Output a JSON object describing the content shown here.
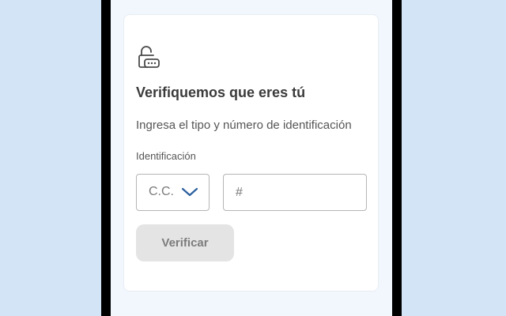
{
  "form": {
    "title": "Verifiquemos que eres tú",
    "subtitle": "Ingresa el tipo y número de identificación",
    "id_label": "Identificación",
    "id_type_selected": "C.C.",
    "id_number_placeholder": "#",
    "id_number_value": "",
    "verify_label": "Verificar"
  },
  "icons": {
    "header_icon": "lock-open-password-icon",
    "select_icon": "chevron-down-icon"
  },
  "colors": {
    "accent": "#2b5f9e",
    "button_disabled_bg": "#e4e4e4",
    "button_disabled_text": "#7c7c7c",
    "background": "#d4e4f7"
  }
}
